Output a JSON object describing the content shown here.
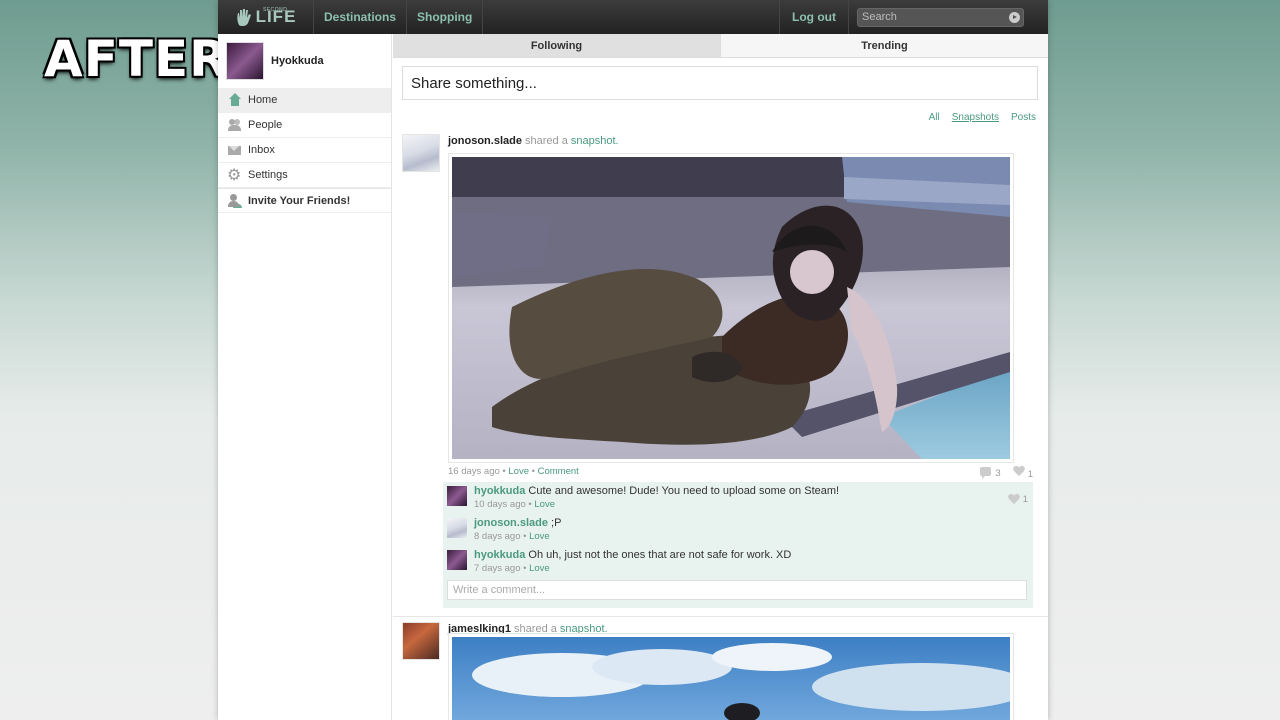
{
  "overlay": {
    "label": "AFTER"
  },
  "topbar": {
    "logo_small": "SECOND",
    "logo_text": "LIFE",
    "nav": [
      {
        "label": "Destinations"
      },
      {
        "label": "Shopping"
      }
    ],
    "logout_label": "Log out",
    "search_placeholder": "Search"
  },
  "profile": {
    "name": "Hyokkuda"
  },
  "sidebar": {
    "items": [
      {
        "label": "Home",
        "icon": "home-icon",
        "active": true
      },
      {
        "label": "People",
        "icon": "people-icon"
      },
      {
        "label": "Inbox",
        "icon": "inbox-icon"
      },
      {
        "label": "Settings",
        "icon": "gear-icon"
      }
    ],
    "invite_label": "Invite Your Friends!"
  },
  "tabs": [
    {
      "label": "Following",
      "active": true
    },
    {
      "label": "Trending"
    }
  ],
  "share_prompt": "Share something...",
  "filters": [
    {
      "label": "All"
    },
    {
      "label": "Snapshots",
      "selected": true
    },
    {
      "label": "Posts"
    }
  ],
  "posts": [
    {
      "author": "jonoson.slade",
      "verb": "shared a",
      "type": "snapshot.",
      "time": "16 days ago",
      "love": "Love",
      "comment": "Comment",
      "comment_count": "3",
      "love_count": "1",
      "comments": [
        {
          "who": "hyokkuda",
          "text": " Cute and awesome! Dude! You need to upload some on Steam!",
          "time": "10 days ago",
          "love": "Love",
          "likes": "1"
        },
        {
          "who": "jonoson.slade",
          "text": " ;P",
          "time": "8 days ago",
          "love": "Love"
        },
        {
          "who": "hyokkuda",
          "text": " Oh uh, just not the ones that are not safe for work. XD",
          "time": "7 days ago",
          "love": "Love"
        }
      ],
      "write_placeholder": "Write a comment..."
    },
    {
      "author": "jameslking1",
      "verb": "shared a",
      "type": "snapshot."
    }
  ],
  "sep": "•"
}
